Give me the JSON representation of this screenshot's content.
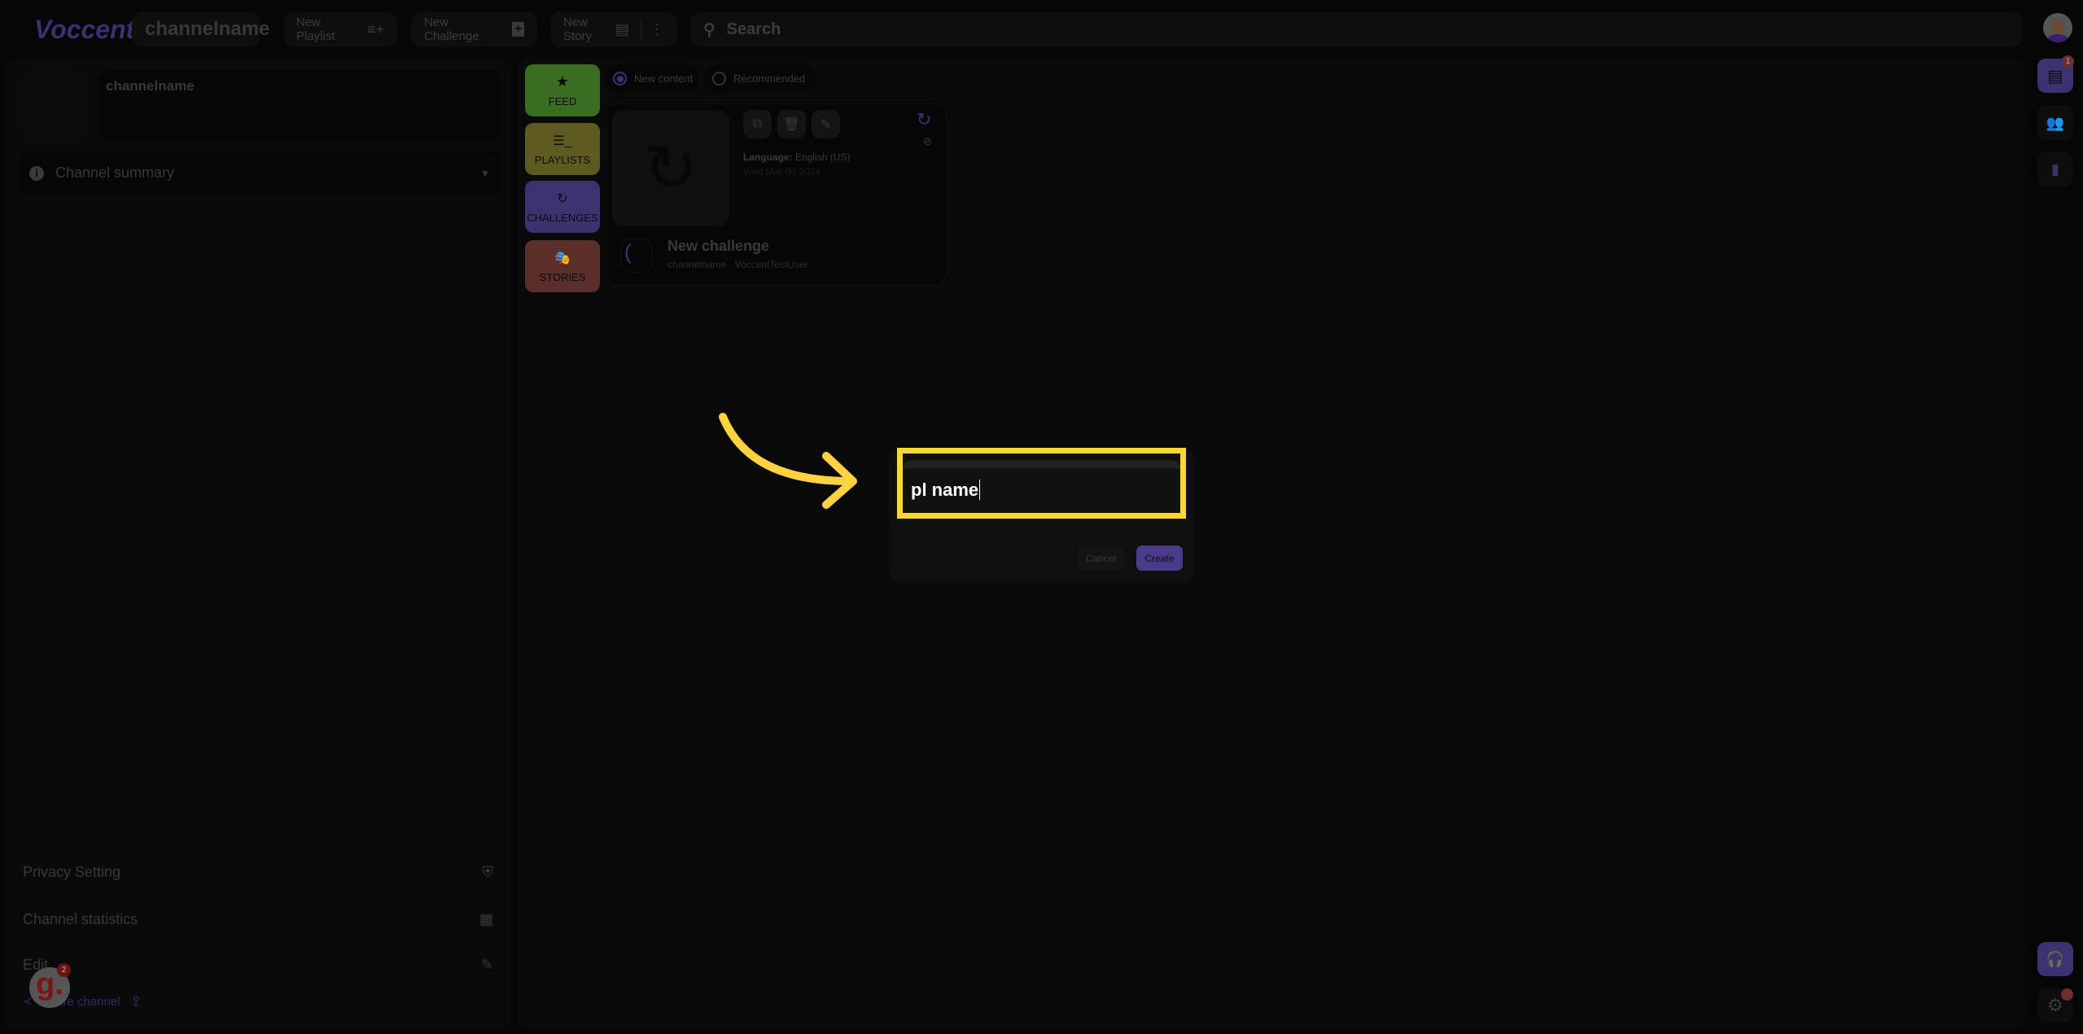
{
  "header": {
    "logo": "Voccent",
    "channel_name": "channelname",
    "new_playlist": "New Playlist",
    "new_challenge": "New Challenge",
    "new_story": "New Story",
    "search_placeholder": "Search"
  },
  "sidebar": {
    "channel_name": "channelname",
    "summary_label": "Channel summary",
    "privacy": "Privacy Setting",
    "statistics": "Channel statistics",
    "edit": "Edit",
    "share": "Share channel"
  },
  "categories": [
    {
      "label": "FEED",
      "color": "#3a6d22"
    },
    {
      "label": "PLAYLISTS",
      "color": "#5c5a1e"
    },
    {
      "label": "CHALLENGES",
      "color": "#3d3270"
    },
    {
      "label": "STORIES",
      "color": "#5a2e2a"
    }
  ],
  "filters": {
    "new_content": "New content",
    "recommended": "Recommended",
    "selected": "New content"
  },
  "card": {
    "language_label": "Language:",
    "language_value": "English (US)",
    "date": "Wed Mar 06 2024",
    "title": "New challenge",
    "subtitle": "channelname · VoccentTestUser"
  },
  "dialog": {
    "input_value": "pl name",
    "cancel": "Cancel",
    "create": "Create"
  },
  "badges": {
    "chat": "1",
    "guidde": "2"
  },
  "colors": {
    "accent": "#4a3a8a",
    "highlight": "#ffd23f"
  }
}
